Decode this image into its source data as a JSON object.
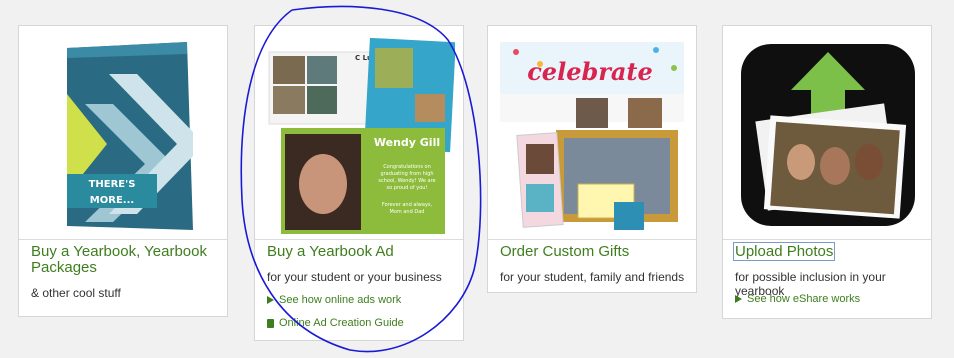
{
  "cards": [
    {
      "title": "Buy a Yearbook, Yearbook Packages",
      "subtitle": "& other cool stuff",
      "image_text": {
        "line1": "THERE'S",
        "line2": "MORE..."
      }
    },
    {
      "title": "Buy a Yearbook Ad",
      "subtitle": "for your student or your business",
      "links": [
        "See how online ads work",
        "Online Ad Creation Guide"
      ],
      "image_text": {
        "name": "Wendy Gill",
        "crew": "C Lunch Crew",
        "message": "Congratulations on graduating from high school, Wendy! We are so proud of you!",
        "signoff": "Forever and always, Mom and Dad"
      }
    },
    {
      "title": "Order Custom Gifts",
      "subtitle": "for your student, family and friends",
      "image_text": {
        "banner": "celebrate"
      }
    },
    {
      "title": "Upload Photos",
      "subtitle": "for possible inclusion in your yearbook",
      "links": [
        "See how eShare works"
      ]
    }
  ],
  "colors": {
    "accent_green": "#3e7e1e",
    "annotation_blue": "#1a1ad6"
  }
}
